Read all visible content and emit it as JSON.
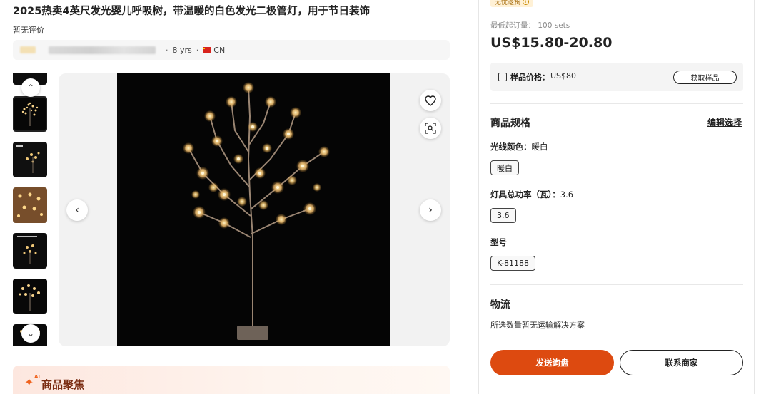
{
  "product": {
    "title": "2025热卖4英尺发光婴儿呼吸树，带温暖的白色发光二极管灯，用于节日装饰",
    "review_status": "暂无评价"
  },
  "supplier": {
    "years": "8 yrs",
    "country": "CN",
    "separator": "·"
  },
  "gallery": {
    "prev_icon": "chevron-left-icon",
    "next_icon": "chevron-right-icon",
    "favorite_icon": "heart-icon",
    "image_search_icon": "image-search-icon",
    "thumbnails_up_icon": "chevron-up-icon",
    "thumbnails_down_icon": "chevron-down-icon"
  },
  "focus_section": {
    "ai_label": "AI",
    "title": "商品聚焦"
  },
  "purchase": {
    "badge": "无忧退货",
    "moq_label": "最低起订量：",
    "moq_value": "100 sets",
    "price": "US$15.80-20.80",
    "sample_label": "样品价格：",
    "sample_value": "US$80",
    "get_sample": "获取样品"
  },
  "specs": {
    "title": "商品规格",
    "edit": "编辑选择",
    "light_color_label": "光线颜色",
    "light_color_value": "暖白",
    "light_color_chip": "暖白",
    "power_label": "灯具总功率（瓦）",
    "power_value": "3.6",
    "power_chip": "3.6",
    "model_label": "型号",
    "model_chip": "K-81188"
  },
  "logistics": {
    "title": "物流",
    "text": "所选数量暂无运输解决方案"
  },
  "actions": {
    "add_to_cart": "发送询盘",
    "contact_supplier": "联系商家"
  },
  "colors": {
    "accent": "#dd4a10",
    "badge_bg": "#fff1d6",
    "image_bg": "#050505"
  }
}
